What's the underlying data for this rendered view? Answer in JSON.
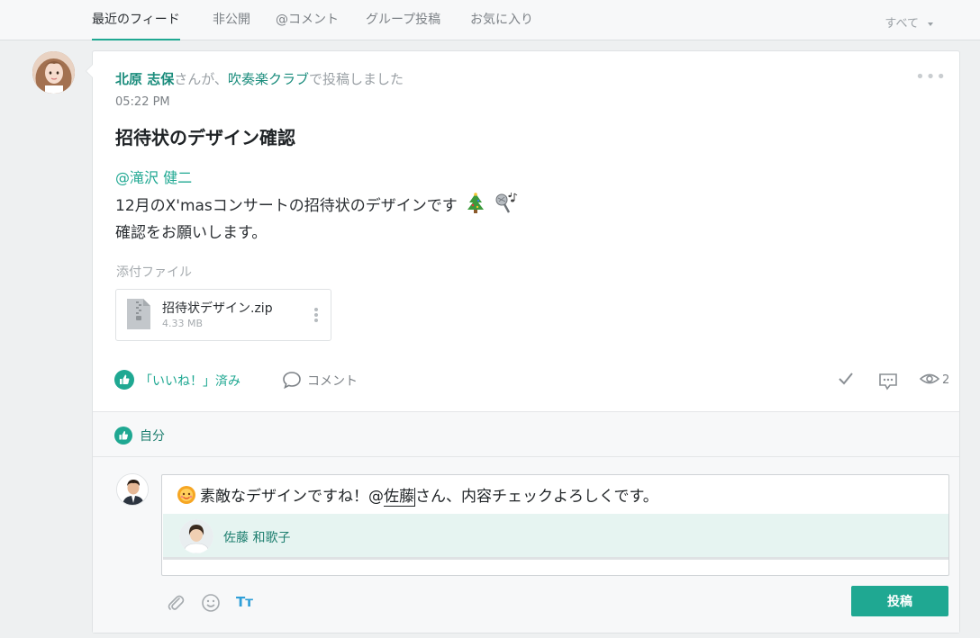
{
  "tabs": [
    {
      "label": "最近のフィード",
      "active": true
    },
    {
      "label": "非公開",
      "active": false
    },
    {
      "label": "@コメント",
      "active": false
    },
    {
      "label": "グループ投稿",
      "active": false
    },
    {
      "label": "お気に入り",
      "active": false
    }
  ],
  "filter": {
    "label": "すべて"
  },
  "post": {
    "author": "北原 志保",
    "text_san": "さんが、",
    "group": "吹奏楽クラブ",
    "text_posted": "で投稿しました",
    "time": "05:22 PM",
    "title": "招待状のデザイン確認",
    "mention": "@滝沢 健二",
    "body_line1": "12月のX'masコンサートの招待状のデザインです",
    "body_line2": "確認をお願いします。",
    "body_emojis": [
      "christmas-tree-icon",
      "microphone-notes-icon"
    ],
    "attachment_label": "添付ファイル",
    "attachment": {
      "name": "招待状デザイン.zip",
      "size": "4.33 MB"
    }
  },
  "actions": {
    "like_label": "「いいね！」済み",
    "comment_label": "コメント",
    "view_count": "2"
  },
  "liked_by": "自分",
  "comment_box": {
    "text_before": "素敵なデザインですね！@",
    "typed": "佐藤",
    "text_after": "さん、内容チェックよろしくです。",
    "suggestion_name": "佐藤 和歌子"
  },
  "submit_label": "投稿",
  "colors": {
    "accent": "#1fa892",
    "link": "#1a8c7c",
    "font_tool": "#2f9fd8"
  }
}
